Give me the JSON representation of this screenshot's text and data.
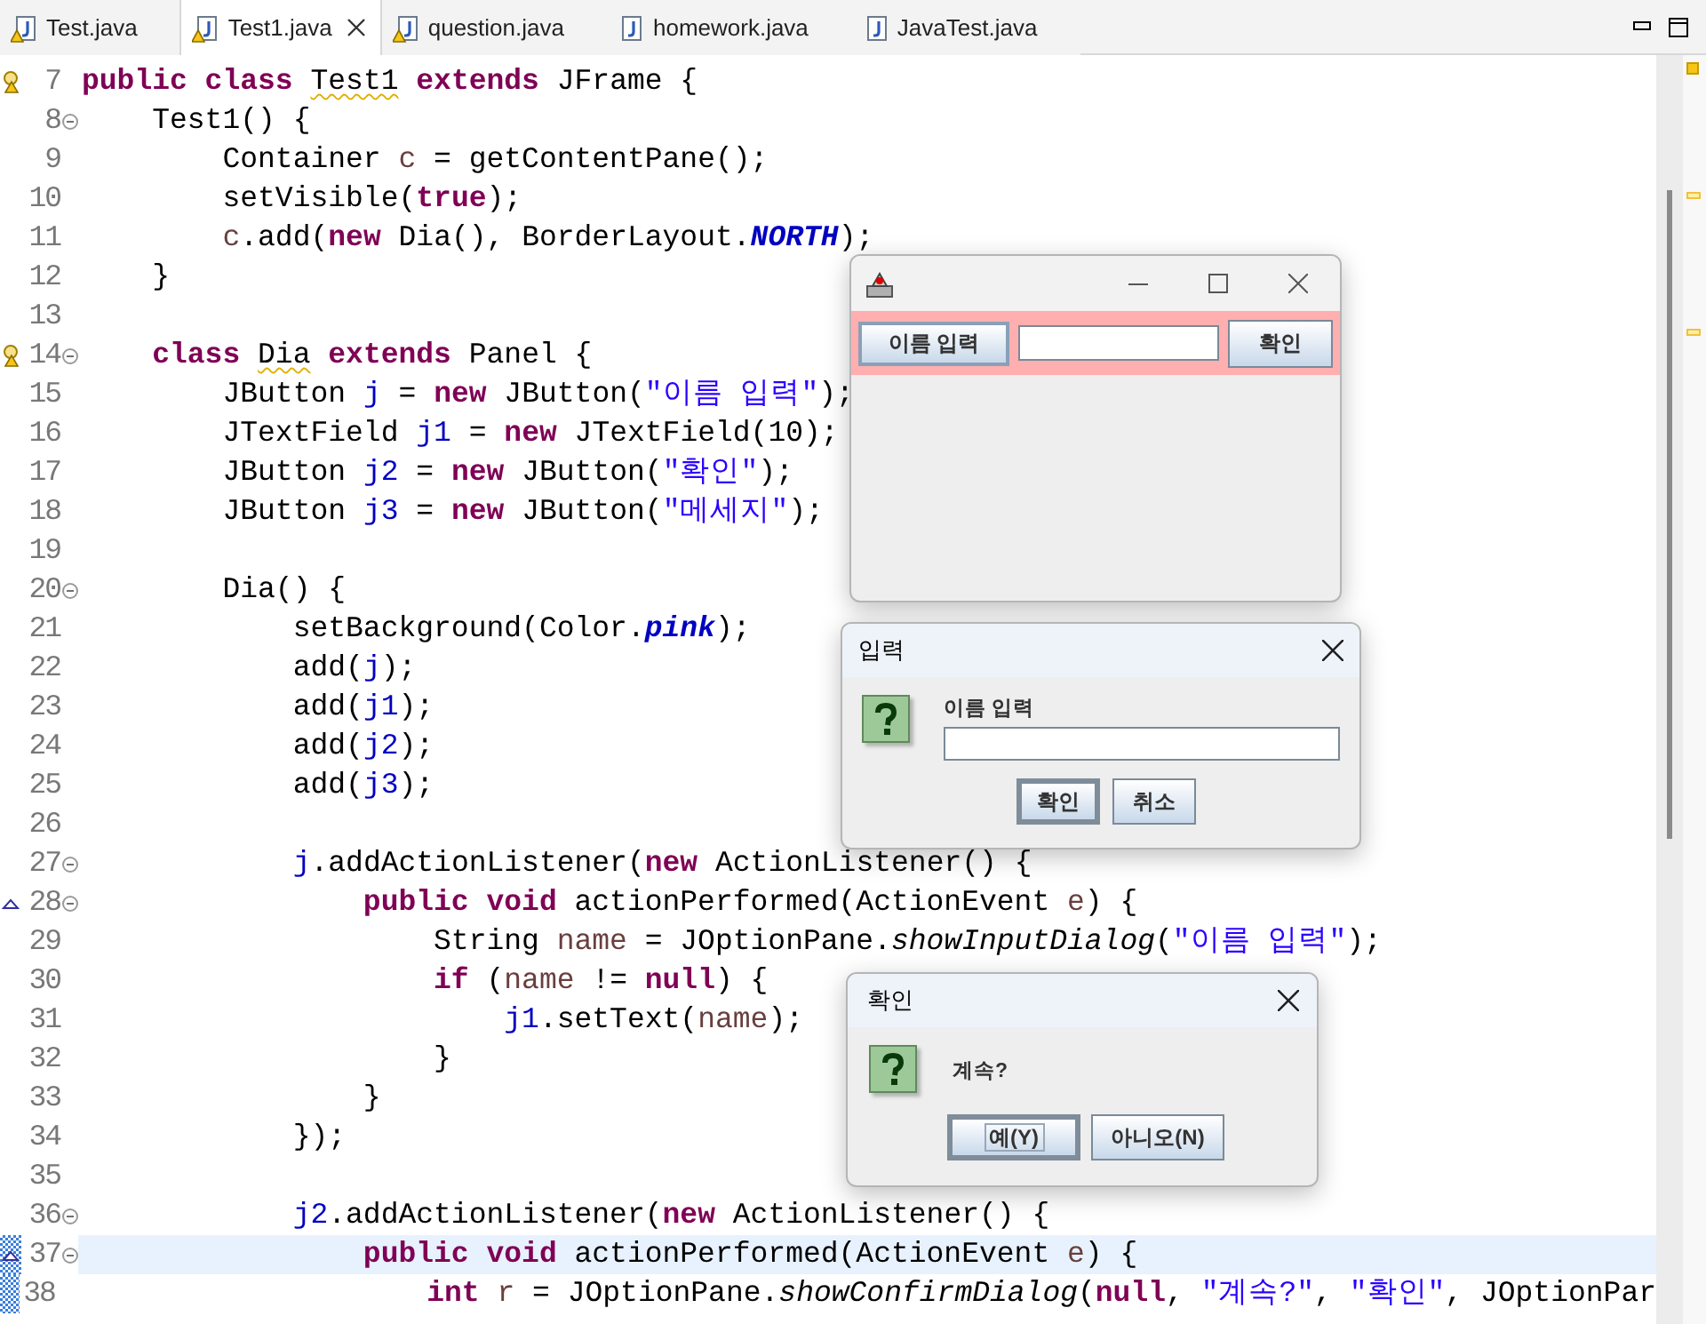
{
  "tabs": [
    {
      "label": "Test.java",
      "selected": false,
      "warning": true
    },
    {
      "label": "Test1.java",
      "selected": true,
      "warning": true
    },
    {
      "label": "question.java",
      "selected": false,
      "warning": true
    },
    {
      "label": "homework.java",
      "selected": false,
      "warning": false
    },
    {
      "label": "JavaTest.java",
      "selected": false,
      "warning": false
    }
  ],
  "editor": {
    "lines": [
      {
        "number": "7",
        "warning": true,
        "fold": false,
        "override": false,
        "current": false,
        "changed": false,
        "tokens": [
          {
            "kind": "keyword",
            "text": "public class "
          },
          {
            "kind": "warned",
            "text": "Test1"
          },
          {
            "kind": "keyword",
            "text": " extends"
          },
          {
            "kind": "plain",
            "text": " JFrame {"
          }
        ]
      },
      {
        "number": "8",
        "warning": false,
        "fold": true,
        "override": false,
        "current": false,
        "changed": false,
        "tokens": [
          {
            "kind": "plain",
            "text": "    Test1() {"
          }
        ]
      },
      {
        "number": "9",
        "warning": false,
        "fold": false,
        "override": false,
        "current": false,
        "changed": false,
        "tokens": [
          {
            "kind": "plain",
            "text": "        Container "
          },
          {
            "kind": "local",
            "text": "c"
          },
          {
            "kind": "plain",
            "text": " = getContentPane();"
          }
        ]
      },
      {
        "number": "10",
        "warning": false,
        "fold": false,
        "override": false,
        "current": false,
        "changed": false,
        "tokens": [
          {
            "kind": "plain",
            "text": "        setVisible("
          },
          {
            "kind": "keyword",
            "text": "true"
          },
          {
            "kind": "plain",
            "text": ");"
          }
        ]
      },
      {
        "number": "11",
        "warning": false,
        "fold": false,
        "override": false,
        "current": false,
        "changed": false,
        "tokens": [
          {
            "kind": "local",
            "text": "        c"
          },
          {
            "kind": "plain",
            "text": ".add("
          },
          {
            "kind": "keyword",
            "text": "new"
          },
          {
            "kind": "plain",
            "text": " Dia(), BorderLayout."
          },
          {
            "kind": "static",
            "text": "NORTH"
          },
          {
            "kind": "plain",
            "text": ");"
          }
        ]
      },
      {
        "number": "12",
        "warning": false,
        "fold": false,
        "override": false,
        "current": false,
        "changed": false,
        "tokens": [
          {
            "kind": "plain",
            "text": "    }"
          }
        ]
      },
      {
        "number": "13",
        "warning": false,
        "fold": false,
        "override": false,
        "current": false,
        "changed": false
      },
      {
        "number": "14",
        "warning": true,
        "fold": true,
        "override": false,
        "current": false,
        "changed": false,
        "tokens": [
          {
            "kind": "keyword",
            "text": "    class "
          },
          {
            "kind": "warned",
            "text": "Dia"
          },
          {
            "kind": "keyword",
            "text": " extends"
          },
          {
            "kind": "plain",
            "text": " Panel {"
          }
        ]
      },
      {
        "number": "15",
        "warning": false,
        "fold": false,
        "override": false,
        "current": false,
        "changed": false,
        "tokens": [
          {
            "kind": "plain",
            "text": "        JButton "
          },
          {
            "kind": "field",
            "text": "j"
          },
          {
            "kind": "plain",
            "text": " = "
          },
          {
            "kind": "keyword",
            "text": "new"
          },
          {
            "kind": "plain",
            "text": " JButton("
          },
          {
            "kind": "string",
            "text": "\"이름 입력\""
          },
          {
            "kind": "plain",
            "text": ");"
          }
        ]
      },
      {
        "number": "16",
        "warning": false,
        "fold": false,
        "override": false,
        "current": false,
        "changed": false,
        "tokens": [
          {
            "kind": "plain",
            "text": "        JTextField "
          },
          {
            "kind": "field",
            "text": "j1"
          },
          {
            "kind": "plain",
            "text": " = "
          },
          {
            "kind": "keyword",
            "text": "new"
          },
          {
            "kind": "plain",
            "text": " JTextField(10);"
          }
        ]
      },
      {
        "number": "17",
        "warning": false,
        "fold": false,
        "override": false,
        "current": false,
        "changed": false,
        "tokens": [
          {
            "kind": "plain",
            "text": "        JButton "
          },
          {
            "kind": "field",
            "text": "j2"
          },
          {
            "kind": "plain",
            "text": " = "
          },
          {
            "kind": "keyword",
            "text": "new"
          },
          {
            "kind": "plain",
            "text": " JButton("
          },
          {
            "kind": "string",
            "text": "\"확인\""
          },
          {
            "kind": "plain",
            "text": ");"
          }
        ]
      },
      {
        "number": "18",
        "warning": false,
        "fold": false,
        "override": false,
        "current": false,
        "changed": false,
        "tokens": [
          {
            "kind": "plain",
            "text": "        JButton "
          },
          {
            "kind": "field",
            "text": "j3"
          },
          {
            "kind": "plain",
            "text": " = "
          },
          {
            "kind": "keyword",
            "text": "new"
          },
          {
            "kind": "plain",
            "text": " JButton("
          },
          {
            "kind": "string",
            "text": "\"메세지\""
          },
          {
            "kind": "plain",
            "text": ");"
          }
        ]
      },
      {
        "number": "19",
        "warning": false,
        "fold": false,
        "override": false,
        "current": false,
        "changed": false
      },
      {
        "number": "20",
        "warning": false,
        "fold": true,
        "override": false,
        "current": false,
        "changed": false,
        "tokens": [
          {
            "kind": "plain",
            "text": "        Dia() {"
          }
        ]
      },
      {
        "number": "21",
        "warning": false,
        "fold": false,
        "override": false,
        "current": false,
        "changed": false,
        "tokens": [
          {
            "kind": "plain",
            "text": "            setBackground(Color."
          },
          {
            "kind": "static",
            "text": "pink"
          },
          {
            "kind": "plain",
            "text": ");"
          }
        ]
      },
      {
        "number": "22",
        "warning": false,
        "fold": false,
        "override": false,
        "current": false,
        "changed": false,
        "tokens": [
          {
            "kind": "plain",
            "text": "            add("
          },
          {
            "kind": "field",
            "text": "j"
          },
          {
            "kind": "plain",
            "text": ");"
          }
        ]
      },
      {
        "number": "23",
        "warning": false,
        "fold": false,
        "override": false,
        "current": false,
        "changed": false,
        "tokens": [
          {
            "kind": "plain",
            "text": "            add("
          },
          {
            "kind": "field",
            "text": "j1"
          },
          {
            "kind": "plain",
            "text": ");"
          }
        ]
      },
      {
        "number": "24",
        "warning": false,
        "fold": false,
        "override": false,
        "current": false,
        "changed": false,
        "tokens": [
          {
            "kind": "plain",
            "text": "            add("
          },
          {
            "kind": "field",
            "text": "j2"
          },
          {
            "kind": "plain",
            "text": ");"
          }
        ]
      },
      {
        "number": "25",
        "warning": false,
        "fold": false,
        "override": false,
        "current": false,
        "changed": false,
        "tokens": [
          {
            "kind": "plain",
            "text": "            add("
          },
          {
            "kind": "field",
            "text": "j3"
          },
          {
            "kind": "plain",
            "text": ");"
          }
        ]
      },
      {
        "number": "26",
        "warning": false,
        "fold": false,
        "override": false,
        "current": false,
        "changed": false
      },
      {
        "number": "27",
        "warning": false,
        "fold": true,
        "override": false,
        "current": false,
        "changed": false,
        "tokens": [
          {
            "kind": "field",
            "text": "            j"
          },
          {
            "kind": "plain",
            "text": ".addActionListener("
          },
          {
            "kind": "keyword",
            "text": "new"
          },
          {
            "kind": "plain",
            "text": " ActionListener() {"
          }
        ]
      },
      {
        "number": "28",
        "warning": false,
        "fold": true,
        "override": true,
        "current": false,
        "changed": false,
        "tokens": [
          {
            "kind": "keyword",
            "text": "                public void "
          },
          {
            "kind": "plain",
            "text": "actionPerformed(ActionEvent "
          },
          {
            "kind": "local",
            "text": "e"
          },
          {
            "kind": "plain",
            "text": ") {"
          }
        ]
      },
      {
        "number": "29",
        "warning": false,
        "fold": false,
        "override": false,
        "current": false,
        "changed": false,
        "tokens": [
          {
            "kind": "plain",
            "text": "                    String "
          },
          {
            "kind": "local",
            "text": "name"
          },
          {
            "kind": "plain",
            "text": " = JOptionPane."
          },
          {
            "kind": "method",
            "text": "showInputDialog"
          },
          {
            "kind": "plain",
            "text": "("
          },
          {
            "kind": "string",
            "text": "\"이름 입력\""
          },
          {
            "kind": "plain",
            "text": ");"
          }
        ]
      },
      {
        "number": "30",
        "warning": false,
        "fold": false,
        "override": false,
        "current": false,
        "changed": false,
        "tokens": [
          {
            "kind": "keyword",
            "text": "                    if"
          },
          {
            "kind": "plain",
            "text": " ("
          },
          {
            "kind": "local",
            "text": "name"
          },
          {
            "kind": "plain",
            "text": " != "
          },
          {
            "kind": "keyword",
            "text": "null"
          },
          {
            "kind": "plain",
            "text": ") {"
          }
        ]
      },
      {
        "number": "31",
        "warning": false,
        "fold": false,
        "override": false,
        "current": false,
        "changed": false,
        "tokens": [
          {
            "kind": "field",
            "text": "                        j1"
          },
          {
            "kind": "plain",
            "text": ".setText("
          },
          {
            "kind": "local",
            "text": "name"
          },
          {
            "kind": "plain",
            "text": ");"
          }
        ]
      },
      {
        "number": "32",
        "warning": false,
        "fold": false,
        "override": false,
        "current": false,
        "changed": false,
        "tokens": [
          {
            "kind": "plain",
            "text": "                    }"
          }
        ]
      },
      {
        "number": "33",
        "warning": false,
        "fold": false,
        "override": false,
        "current": false,
        "changed": false,
        "tokens": [
          {
            "kind": "plain",
            "text": "                }"
          }
        ]
      },
      {
        "number": "34",
        "warning": false,
        "fold": false,
        "override": false,
        "current": false,
        "changed": false,
        "tokens": [
          {
            "kind": "plain",
            "text": "            });"
          }
        ]
      },
      {
        "number": "35",
        "warning": false,
        "fold": false,
        "override": false,
        "current": false,
        "changed": false
      },
      {
        "number": "36",
        "warning": false,
        "fold": true,
        "override": false,
        "current": false,
        "changed": false,
        "tokens": [
          {
            "kind": "field",
            "text": "            j2"
          },
          {
            "kind": "plain",
            "text": ".addActionListener("
          },
          {
            "kind": "keyword",
            "text": "new"
          },
          {
            "kind": "plain",
            "text": " ActionListener() {"
          }
        ]
      },
      {
        "number": "37",
        "warning": false,
        "fold": true,
        "override": true,
        "current": true,
        "changed": true,
        "tokens": [
          {
            "kind": "keyword",
            "text": "                public void "
          },
          {
            "kind": "plain",
            "text": "actionPerformed(ActionEvent "
          },
          {
            "kind": "local",
            "text": "e"
          },
          {
            "kind": "plain",
            "text": ") {"
          }
        ]
      },
      {
        "number": "38",
        "warning": false,
        "fold": false,
        "override": false,
        "current": false,
        "changed": true,
        "tokens": [
          {
            "kind": "keyword",
            "text": "                    int"
          },
          {
            "kind": "local",
            "text": " r"
          },
          {
            "kind": "plain",
            "text": " = JOptionPane."
          },
          {
            "kind": "method",
            "text": "showConfirmDialog"
          },
          {
            "kind": "plain",
            "text": "("
          },
          {
            "kind": "keyword",
            "text": "null"
          },
          {
            "kind": "plain",
            "text": ", "
          },
          {
            "kind": "string",
            "text": "\"계속?\""
          },
          {
            "kind": "plain",
            "text": ", "
          },
          {
            "kind": "string",
            "text": "\"확인\""
          },
          {
            "kind": "plain",
            "text": ", JOptionPar"
          }
        ]
      }
    ]
  },
  "frame_window": {
    "buttons": [
      {
        "label": "이름 입력"
      },
      {
        "label": "확인"
      }
    ]
  },
  "input_dialog": {
    "title": "입력",
    "message": "이름 입력",
    "buttons": [
      {
        "label": "확인",
        "default": true
      },
      {
        "label": "취소",
        "default": false
      }
    ]
  },
  "confirm_dialog": {
    "title": "확인",
    "message": "계속?",
    "buttons": [
      {
        "label": "예(Y)",
        "default": true
      },
      {
        "label": "아니오(N)",
        "default": false
      }
    ]
  }
}
